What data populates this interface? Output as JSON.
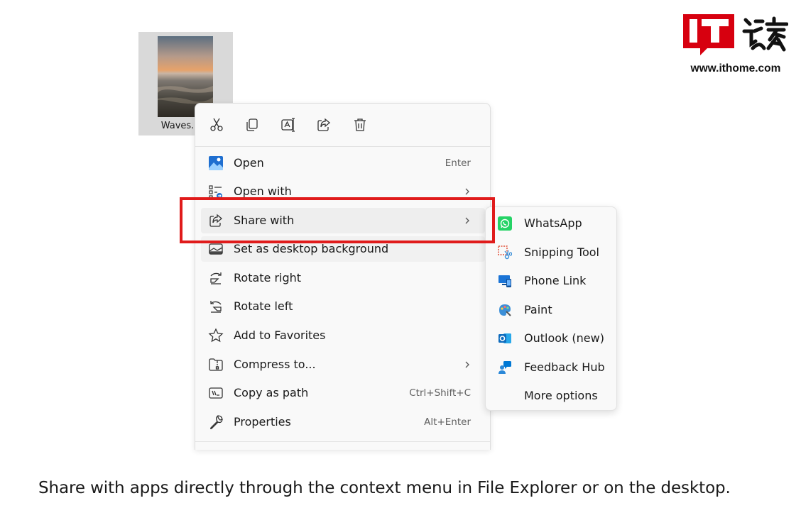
{
  "logo": {
    "mark": "IT",
    "cn_text": "之家",
    "url": "www.ithome.com",
    "brand_color": "#d7000f"
  },
  "file": {
    "name": "Waves.",
    "thumbnail": "sunset-beach-photo"
  },
  "context_menu": {
    "quick_actions": [
      {
        "name": "cut",
        "icon": "scissors-icon"
      },
      {
        "name": "copy",
        "icon": "copy-icon"
      },
      {
        "name": "rename",
        "icon": "rename-icon"
      },
      {
        "name": "share",
        "icon": "share-icon"
      },
      {
        "name": "delete",
        "icon": "trash-icon"
      }
    ],
    "items": [
      {
        "label": "Open",
        "shortcut": "Enter",
        "icon": "photos-app-icon"
      },
      {
        "label": "Open with",
        "icon": "open-with-icon",
        "submenu": true
      },
      {
        "label": "Share with",
        "icon": "share-icon",
        "submenu": true,
        "highlighted": true
      },
      {
        "label": "Set as desktop background",
        "icon": "desktop-background-icon"
      },
      {
        "label": "Rotate right",
        "icon": "rotate-right-icon"
      },
      {
        "label": "Rotate left",
        "icon": "rotate-left-icon"
      },
      {
        "label": "Add to Favorites",
        "icon": "star-icon"
      },
      {
        "label": "Compress to...",
        "icon": "zip-folder-icon",
        "submenu": true
      },
      {
        "label": "Copy as path",
        "shortcut": "Ctrl+Shift+C",
        "icon": "copy-path-icon"
      },
      {
        "label": "Properties",
        "shortcut": "Alt+Enter",
        "icon": "wrench-icon"
      }
    ]
  },
  "share_submenu": {
    "items": [
      {
        "label": "WhatsApp",
        "icon": "whatsapp-icon",
        "color": "#25d366"
      },
      {
        "label": "Snipping Tool",
        "icon": "snipping-tool-icon",
        "color": "#e0533a"
      },
      {
        "label": "Phone Link",
        "icon": "phone-link-icon",
        "color": "#1b74d6"
      },
      {
        "label": "Paint",
        "icon": "paint-icon",
        "color": "#3b8fd8"
      },
      {
        "label": "Outlook (new)",
        "icon": "outlook-icon",
        "color": "#0f6cbd"
      },
      {
        "label": "Feedback Hub",
        "icon": "feedback-hub-icon",
        "color": "#0078d4"
      },
      {
        "label": "More options",
        "icon": ""
      }
    ]
  },
  "caption": "Share with apps directly through the context menu in File Explorer or on the desktop.",
  "colors": {
    "highlight_box": "#e01b1b",
    "menu_bg": "#f9f9f9",
    "hover_bg": "#eeeeee"
  }
}
